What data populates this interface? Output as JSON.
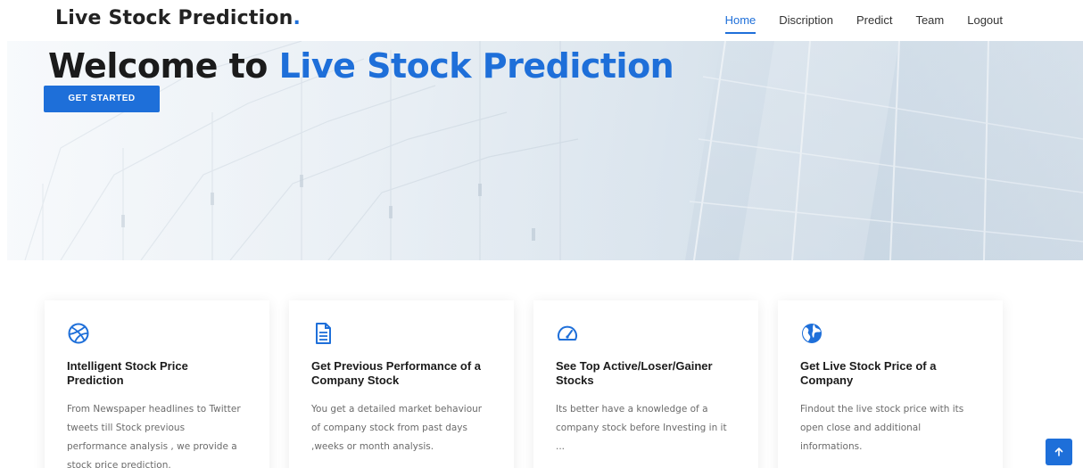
{
  "brand": {
    "name": "Live Stock Prediction",
    "dot": ".",
    "accent": "#1e6fd9"
  },
  "nav": {
    "items": [
      {
        "label": "Home",
        "active": true
      },
      {
        "label": "Discription",
        "active": false
      },
      {
        "label": "Predict",
        "active": false
      },
      {
        "label": "Team",
        "active": false
      },
      {
        "label": "Logout",
        "active": false
      }
    ]
  },
  "hero": {
    "title_prefix": "Welcome to",
    "title_brand": "Live Stock Prediction",
    "cta_label": "GET STARTED"
  },
  "cards": [
    {
      "icon": "dribbble-ball-icon",
      "title": "Intelligent Stock Price Prediction",
      "text": "From Newspaper headlines to Twitter tweets till Stock previous performance analysis , we provide a stock price prediction."
    },
    {
      "icon": "document-icon",
      "title": "Get Previous Performance of a Company Stock",
      "text": "You get a detailed market behaviour of company stock from past days ,weeks or month analysis."
    },
    {
      "icon": "speedometer-icon",
      "title": "See Top Active/Loser/Gainer Stocks",
      "text": "Its better have a knowledge of a company stock before Investing in it ..."
    },
    {
      "icon": "globe-icon",
      "title": "Get Live Stock Price of a Company",
      "text": "Findout the live stock price with its open close and additional informations."
    }
  ],
  "back_to_top": {
    "icon": "arrow-up-icon"
  }
}
